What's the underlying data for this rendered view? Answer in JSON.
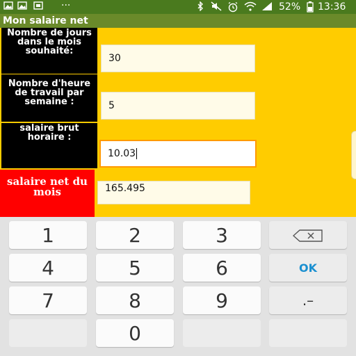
{
  "status_bar": {
    "battery": "52%",
    "time": "13:36",
    "overflow": "···"
  },
  "app": {
    "title": "Mon salaire net"
  },
  "form": {
    "days_label": "Nombre de jours dans le mois souhaité:",
    "days_value": "30",
    "hours_label": "Nombre d'heure de travail par semaine :",
    "hours_value": "5",
    "rate_label": "salaire brut horaire :",
    "rate_value": "10.03",
    "result_label": "salaire net du mois",
    "result_value": "165.495"
  },
  "keyboard": {
    "keys": [
      "1",
      "2",
      "3",
      "4",
      "5",
      "6",
      "7",
      "8",
      "9",
      "0"
    ],
    "ok_label": "OK",
    "decimal_label": ".–"
  },
  "colors": {
    "background": "#ffcc00",
    "label_bg": "#000000",
    "result_bg": "#ff0000",
    "status_bar": "#4a7a1e",
    "accent": "#ff9900"
  }
}
